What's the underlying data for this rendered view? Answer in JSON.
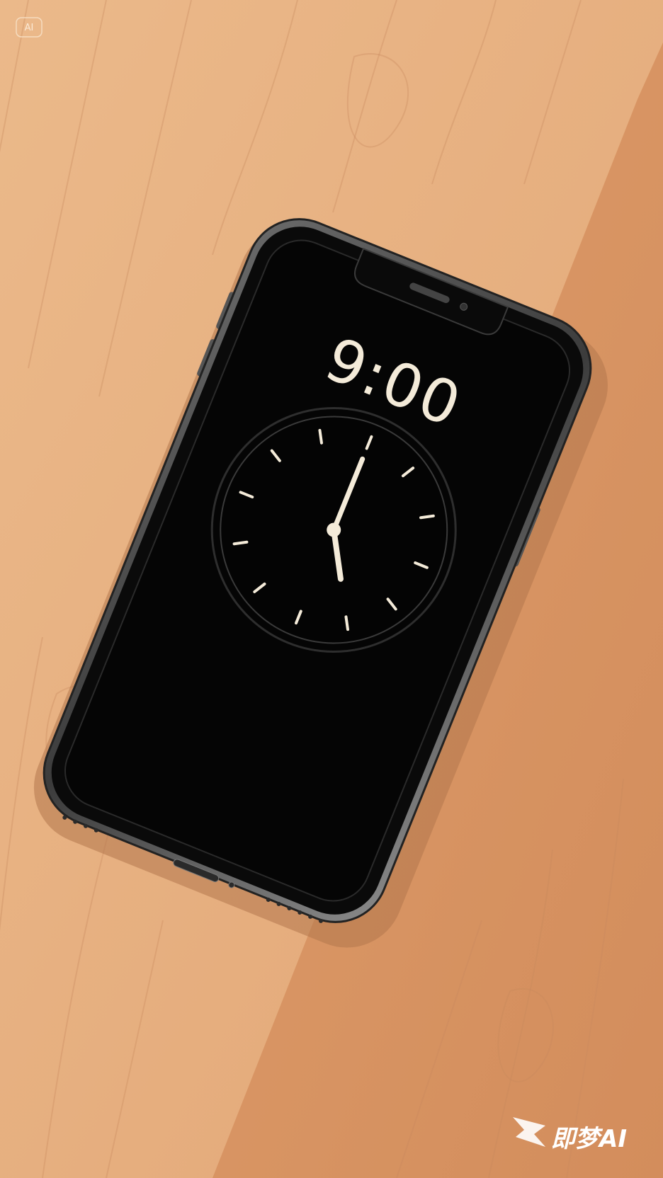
{
  "corner_badge": {
    "label": "AI"
  },
  "phone": {
    "screen": {
      "time_text": "9:00",
      "analog_clock": {
        "hour": 5,
        "minute": 0,
        "tick_count": 12
      }
    }
  },
  "watermark": {
    "text": "即梦AI"
  },
  "colors": {
    "wood_light": "#eab786",
    "wood_mid": "#e0a373",
    "wood_dark": "#d58f5f",
    "phone_frame": "#4a4a4a",
    "screen": "#050505",
    "clock_ink": "#f4ebd9"
  }
}
